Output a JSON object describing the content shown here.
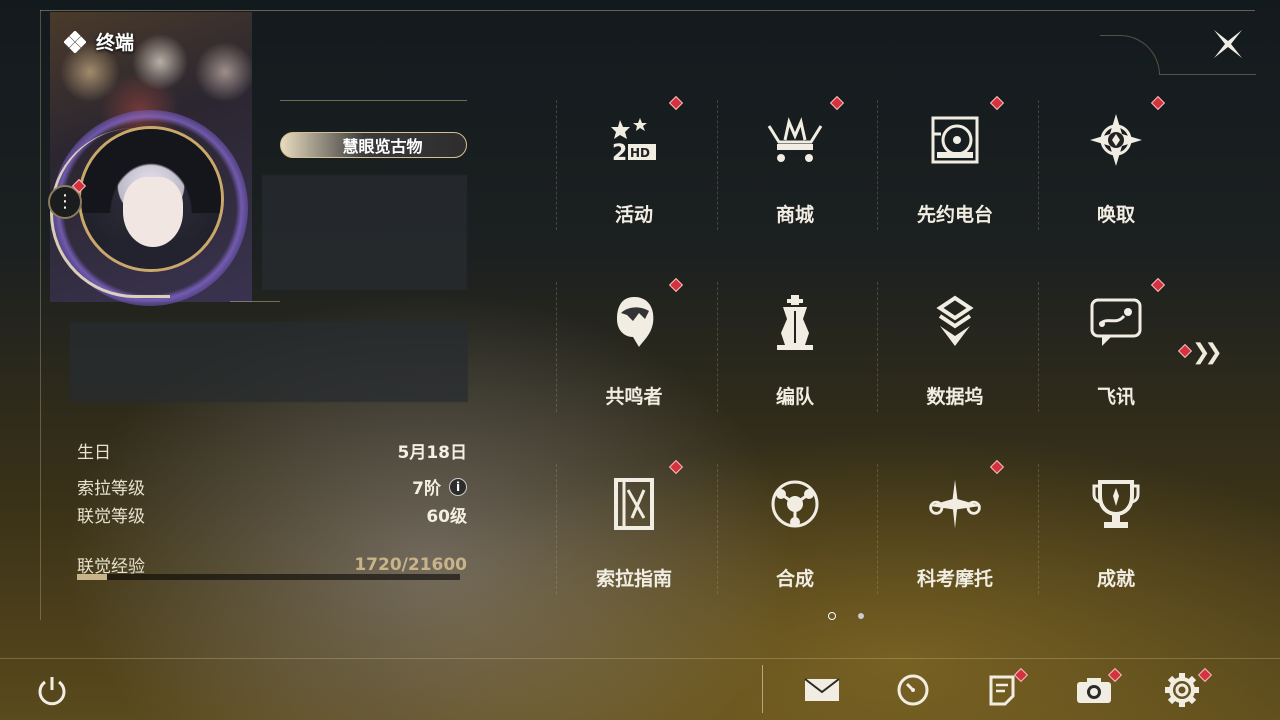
{
  "profile": {
    "terminal_label": "终端",
    "title_chip": "慧眼览古物"
  },
  "stats": {
    "birthday_label": "生日",
    "birthday_value": "5月18日",
    "sola_level_label": "索拉等级",
    "sola_level_value": "7阶",
    "union_level_label": "联觉等级",
    "union_level_value": "60级",
    "union_exp_label": "联觉经验",
    "union_exp_value": "1720/21600",
    "union_exp_fraction": 0.0796
  },
  "menu": {
    "items": [
      {
        "label": "活动",
        "icon": "event-2hd-icon",
        "badge": true
      },
      {
        "label": "商城",
        "icon": "shop-cart-icon",
        "badge": true
      },
      {
        "label": "先约电台",
        "icon": "radio-icon",
        "badge": true
      },
      {
        "label": "唤取",
        "icon": "convene-icon",
        "badge": true
      },
      {
        "label": "共鸣者",
        "icon": "resonator-icon",
        "badge": true
      },
      {
        "label": "编队",
        "icon": "team-icon",
        "badge": false
      },
      {
        "label": "数据坞",
        "icon": "data-bank-icon",
        "badge": false
      },
      {
        "label": "飞讯",
        "icon": "message-icon",
        "badge": true
      },
      {
        "label": "索拉指南",
        "icon": "guidebook-icon",
        "badge": true
      },
      {
        "label": "合成",
        "icon": "synthesis-icon",
        "badge": false
      },
      {
        "label": "科考摩托",
        "icon": "motorbike-icon",
        "badge": true
      },
      {
        "label": "成就",
        "icon": "achievement-trophy-icon",
        "badge": false
      }
    ],
    "next_page_icon": "double-chevron-right-icon"
  },
  "bottom_bar": {
    "power_icon": "power-icon",
    "mail_icon": "mail-icon",
    "clock_icon": "clock-icon",
    "notes_icon": "notes-icon",
    "camera_icon": "camera-icon",
    "settings_icon": "gear-icon"
  },
  "colors": {
    "badge_red": "#d4323e",
    "gold_accent": "#c9a86a",
    "text_cream": "#f2ede2"
  }
}
